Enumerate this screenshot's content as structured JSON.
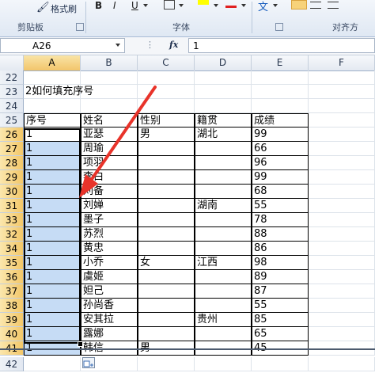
{
  "ribbon": {
    "format_painter_label": "格式刷",
    "bold_glyph": "B",
    "italic_glyph": "I",
    "underline_glyph": "U",
    "text_direction_glyph": "文",
    "groups": {
      "clipboard": "剪贴板",
      "font": "字体",
      "alignment": "对齐方"
    }
  },
  "formula_bar": {
    "name_box": "A26",
    "fx_label": "fx",
    "value": "1"
  },
  "columns": [
    "A",
    "B",
    "C",
    "D",
    "E",
    "F"
  ],
  "rows": [
    {
      "num": "22",
      "cells": [
        "",
        "",
        "",
        "",
        "",
        ""
      ]
    },
    {
      "num": "23",
      "cells": [
        "2如何填充序号",
        "",
        "",
        "",
        "",
        ""
      ]
    },
    {
      "num": "24",
      "cells": [
        "",
        "",
        "",
        "",
        "",
        ""
      ]
    },
    {
      "num": "25",
      "cells": [
        "序号",
        "姓名",
        "性别",
        "籍贯",
        "成绩",
        ""
      ]
    },
    {
      "num": "26",
      "cells": [
        "1",
        "亚瑟",
        "男",
        "湖北",
        "99",
        ""
      ]
    },
    {
      "num": "27",
      "cells": [
        "1",
        "周瑜",
        "",
        "",
        "66",
        ""
      ]
    },
    {
      "num": "28",
      "cells": [
        "1",
        "项羽",
        "",
        "",
        "96",
        ""
      ]
    },
    {
      "num": "29",
      "cells": [
        "1",
        "李白",
        "",
        "",
        "99",
        ""
      ]
    },
    {
      "num": "30",
      "cells": [
        "1",
        "刘备",
        "",
        "",
        "68",
        ""
      ]
    },
    {
      "num": "31",
      "cells": [
        "1",
        "刘婵",
        "",
        "湖南",
        "55",
        ""
      ]
    },
    {
      "num": "33",
      "cells": [
        "1",
        "墨子",
        "",
        "",
        "78",
        ""
      ]
    },
    {
      "num": "32",
      "cells": [
        "1",
        "苏烈",
        "",
        "",
        "88",
        ""
      ]
    },
    {
      "num": "34",
      "cells": [
        "1",
        "黄忠",
        "",
        "",
        "86",
        ""
      ]
    },
    {
      "num": "35",
      "cells": [
        "1",
        "小乔",
        "女",
        "江西",
        "98",
        ""
      ]
    },
    {
      "num": "36",
      "cells": [
        "1",
        "虞姬",
        "",
        "",
        "89",
        ""
      ]
    },
    {
      "num": "37",
      "cells": [
        "1",
        "妲己",
        "",
        "",
        "87",
        ""
      ]
    },
    {
      "num": "38",
      "cells": [
        "1",
        "孙尚香",
        "",
        "",
        "55",
        ""
      ]
    },
    {
      "num": "39",
      "cells": [
        "1",
        "安其拉",
        "",
        "贵州",
        "85",
        ""
      ]
    },
    {
      "num": "40",
      "cells": [
        "1",
        "露娜",
        "",
        "",
        "65",
        ""
      ]
    },
    {
      "num": "41",
      "cells": [
        "1",
        "韩信",
        "男",
        "",
        "45",
        ""
      ]
    },
    {
      "num": "42",
      "cells": [
        "",
        "",
        "",
        "",
        "",
        ""
      ]
    }
  ],
  "colors": {
    "selection_fill": "#c6dcf5",
    "annotation_arrow": "#e8332a",
    "selected_header": "#f3c768"
  },
  "icons": [
    "format-painter-icon",
    "borders-icon",
    "fill-color-icon",
    "font-color-icon",
    "align-left-icon",
    "align-center-icon",
    "autofill-options-icon",
    "dialog-launcher-icon"
  ]
}
